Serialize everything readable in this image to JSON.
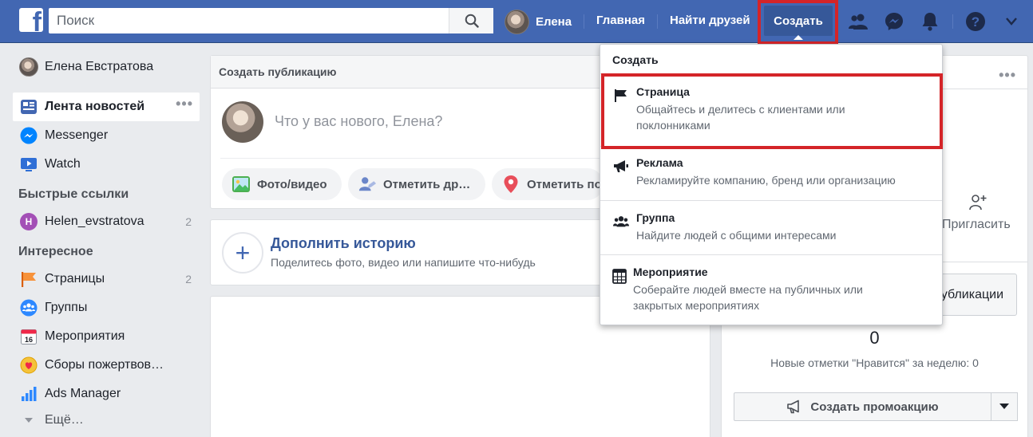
{
  "topbar": {
    "logo_letter": "f",
    "search_placeholder": "Поиск",
    "user_name": "Елена",
    "nav_home": "Главная",
    "nav_find_friends": "Найти друзей",
    "nav_create": "Создать",
    "bar_color": "#4267b2"
  },
  "left_nav": {
    "profile_name": "Елена Евстратова",
    "main_items": [
      {
        "label": "Лента новостей",
        "icon": "news-feed-icon",
        "active": true,
        "more": "•••"
      },
      {
        "label": "Messenger",
        "icon": "messenger-icon"
      },
      {
        "label": "Watch",
        "icon": "watch-icon"
      }
    ],
    "shortcuts_header": "Быстрые ссылки",
    "shortcuts": [
      {
        "avatar_letter": "H",
        "label": "Helen_evstratova",
        "count": "2"
      }
    ],
    "explore_header": "Интересное",
    "explore": [
      {
        "label": "Страницы",
        "icon": "pages-flag-icon",
        "count": "2"
      },
      {
        "label": "Группы",
        "icon": "groups-icon"
      },
      {
        "label": "Мероприятия",
        "icon": "events-calendar-icon",
        "calendar_day": "16"
      },
      {
        "label": "Сборы пожертвов…",
        "icon": "fundraisers-icon"
      },
      {
        "label": "Ads Manager",
        "icon": "ads-manager-icon"
      },
      {
        "label": "Ещё…",
        "icon": "chevron-down-icon"
      }
    ]
  },
  "composer": {
    "header": "Создать публикацию",
    "placeholder": "Что у вас нового, Елена?",
    "actions": [
      {
        "label": "Фото/видео",
        "icon": "photo-video-icon"
      },
      {
        "label": "Отметить др…",
        "icon": "tag-friends-icon"
      },
      {
        "label": "Отметить по",
        "icon": "checkin-pin-icon"
      }
    ]
  },
  "story": {
    "plus": "+",
    "title": "Дополнить историю",
    "subtitle": "Поделитесь фото, видео или напишите что-нибудь"
  },
  "right_panel": {
    "more": "•••",
    "invite_label": "Пригласить",
    "publications_label": "убликации",
    "likes_count": "0",
    "likes_caption": "Новые отметки \"Нравится\" за неделю: 0",
    "promo_label": "Создать промоакцию"
  },
  "dropdown": {
    "header": "Создать",
    "items": [
      {
        "title": "Страница",
        "desc": "Общайтесь и делитесь с клиентами или поклонниками",
        "icon": "flag-icon"
      },
      {
        "title": "Реклама",
        "desc": "Рекламируйте компанию, бренд или организацию",
        "icon": "megaphone-icon"
      },
      {
        "title": "Группа",
        "desc": "Найдите людей с общими интересами",
        "icon": "group-icon"
      },
      {
        "title": "Мероприятие",
        "desc": "Соберайте людей вместе на публичных или закрытых мероприятиях",
        "icon": "calendar-icon"
      }
    ]
  },
  "colors": {
    "highlight_red": "#d42428",
    "link_blue": "#365899"
  }
}
